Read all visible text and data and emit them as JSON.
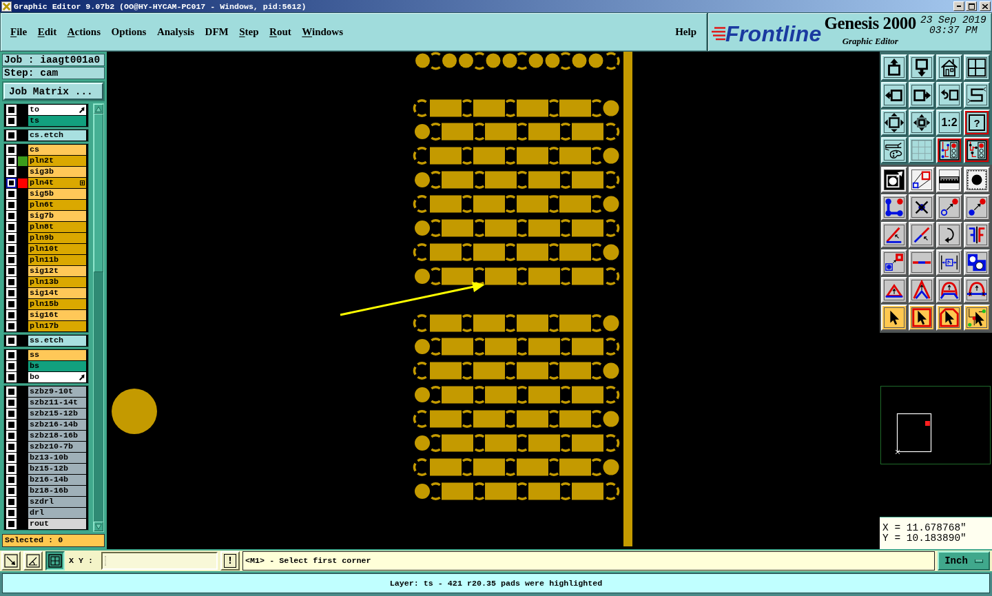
{
  "window": {
    "title": "Graphic Editor 9.07b2 (OO@HY-HYCAM-PC017 - Windows, pid:5612)"
  },
  "menu": [
    {
      "label": "File",
      "underline": true
    },
    {
      "label": "Edit",
      "underline": true
    },
    {
      "label": "Actions",
      "underline": true
    },
    {
      "label": "Options",
      "underline": false
    },
    {
      "label": "Analysis",
      "underline": false
    },
    {
      "label": "DFM",
      "underline": false
    },
    {
      "label": "Step",
      "underline": true
    },
    {
      "label": "Rout",
      "underline": true
    },
    {
      "label": "Windows",
      "underline": true
    }
  ],
  "help_menu": {
    "label": "Help",
    "underline": false
  },
  "brand": {
    "logo": "Frontline",
    "product": "Genesis 2000",
    "subtitle": "Graphic Editor",
    "date": "23 Sep 2019",
    "time": "03:37 PM"
  },
  "job_panel": {
    "job": "Job : iaagt001a0",
    "step": "Step: cam",
    "matrix_button": "Job Matrix ...",
    "selected": "Selected : 0"
  },
  "layer_groups": [
    {
      "layers": [
        {
          "name": "to",
          "kind": "silk",
          "checked": false,
          "selected": false,
          "hand_mark": true,
          "grid_mark": false
        },
        {
          "name": "ts",
          "kind": "mask",
          "checked": false,
          "selected": false,
          "hand_mark": false,
          "grid_mark": false
        }
      ]
    },
    {
      "layers": [
        {
          "name": "cs.etch",
          "kind": "etch",
          "checked": false,
          "selected": false,
          "hand_mark": false,
          "grid_mark": false
        }
      ]
    },
    {
      "layers": [
        {
          "name": "cs",
          "kind": "signal",
          "checked": false,
          "selected": false,
          "hand_mark": false,
          "grid_mark": false
        },
        {
          "name": "pln2t",
          "kind": "power",
          "checked": false,
          "selected": false,
          "hand_mark": false,
          "grid_mark": false,
          "color": "#3c9c1c"
        },
        {
          "name": "sig3b",
          "kind": "signal",
          "checked": false,
          "selected": false,
          "hand_mark": false,
          "grid_mark": false
        },
        {
          "name": "pln4t",
          "kind": "power",
          "checked": false,
          "selected": true,
          "hand_mark": false,
          "grid_mark": true,
          "color": "#ff0000"
        },
        {
          "name": "sig5b",
          "kind": "signal",
          "checked": false,
          "selected": false,
          "hand_mark": false,
          "grid_mark": false
        },
        {
          "name": "pln6t",
          "kind": "power",
          "checked": false,
          "selected": false,
          "hand_mark": false,
          "grid_mark": false
        },
        {
          "name": "sig7b",
          "kind": "signal",
          "checked": false,
          "selected": false,
          "hand_mark": false,
          "grid_mark": false
        },
        {
          "name": "pln8t",
          "kind": "power",
          "checked": false,
          "selected": false,
          "hand_mark": false,
          "grid_mark": false
        },
        {
          "name": "pln9b",
          "kind": "power",
          "checked": false,
          "selected": false,
          "hand_mark": false,
          "grid_mark": false
        },
        {
          "name": "pln10t",
          "kind": "power",
          "checked": false,
          "selected": false,
          "hand_mark": false,
          "grid_mark": false
        },
        {
          "name": "pln11b",
          "kind": "power",
          "checked": false,
          "selected": false,
          "hand_mark": false,
          "grid_mark": false
        },
        {
          "name": "sig12t",
          "kind": "signal",
          "checked": false,
          "selected": false,
          "hand_mark": false,
          "grid_mark": false
        },
        {
          "name": "pln13b",
          "kind": "power",
          "checked": false,
          "selected": false,
          "hand_mark": false,
          "grid_mark": false
        },
        {
          "name": "sig14t",
          "kind": "signal",
          "checked": false,
          "selected": false,
          "hand_mark": false,
          "grid_mark": false
        },
        {
          "name": "pln15b",
          "kind": "power",
          "checked": false,
          "selected": false,
          "hand_mark": false,
          "grid_mark": false
        },
        {
          "name": "sig16t",
          "kind": "signal",
          "checked": false,
          "selected": false,
          "hand_mark": false,
          "grid_mark": false
        },
        {
          "name": "pln17b",
          "kind": "power",
          "checked": false,
          "selected": false,
          "hand_mark": false,
          "grid_mark": false
        }
      ]
    },
    {
      "layers": [
        {
          "name": "ss.etch",
          "kind": "etch",
          "checked": false,
          "selected": false,
          "hand_mark": false,
          "grid_mark": false
        }
      ]
    },
    {
      "layers": [
        {
          "name": "ss",
          "kind": "signal",
          "checked": false,
          "selected": false,
          "hand_mark": false,
          "grid_mark": false
        },
        {
          "name": "bs",
          "kind": "mask",
          "checked": false,
          "selected": false,
          "hand_mark": false,
          "grid_mark": false
        },
        {
          "name": "bo",
          "kind": "silk",
          "checked": false,
          "selected": false,
          "hand_mark": true,
          "grid_mark": false
        }
      ]
    },
    {
      "layers": [
        {
          "name": "szbz9-10t",
          "kind": "drill",
          "checked": false,
          "selected": false,
          "hand_mark": false,
          "grid_mark": false
        },
        {
          "name": "szbz11-14t",
          "kind": "drill",
          "checked": false,
          "selected": false,
          "hand_mark": false,
          "grid_mark": false
        },
        {
          "name": "szbz15-12b",
          "kind": "drill",
          "checked": false,
          "selected": false,
          "hand_mark": false,
          "grid_mark": false
        },
        {
          "name": "szbz16-14b",
          "kind": "drill",
          "checked": false,
          "selected": false,
          "hand_mark": false,
          "grid_mark": false
        },
        {
          "name": "szbz18-16b",
          "kind": "drill",
          "checked": false,
          "selected": false,
          "hand_mark": false,
          "grid_mark": false
        },
        {
          "name": "szbz10-7b",
          "kind": "drill",
          "checked": false,
          "selected": false,
          "hand_mark": false,
          "grid_mark": false
        },
        {
          "name": "bz13-10b",
          "kind": "drill",
          "checked": false,
          "selected": false,
          "hand_mark": false,
          "grid_mark": false
        },
        {
          "name": "bz15-12b",
          "kind": "drill",
          "checked": false,
          "selected": false,
          "hand_mark": false,
          "grid_mark": false
        },
        {
          "name": "bz16-14b",
          "kind": "drill",
          "checked": false,
          "selected": false,
          "hand_mark": false,
          "grid_mark": false
        },
        {
          "name": "bz18-16b",
          "kind": "drill",
          "checked": false,
          "selected": false,
          "hand_mark": false,
          "grid_mark": false
        },
        {
          "name": "szdrl",
          "kind": "drill",
          "checked": false,
          "selected": false,
          "hand_mark": false,
          "grid_mark": false
        },
        {
          "name": "drl",
          "kind": "drill",
          "checked": false,
          "selected": false,
          "hand_mark": false,
          "grid_mark": false
        },
        {
          "name": "rout",
          "kind": "rout",
          "checked": false,
          "selected": false,
          "hand_mark": false,
          "grid_mark": false
        }
      ]
    }
  ],
  "view_tools": [
    {
      "on": false
    },
    {
      "on": false
    },
    {
      "on": false
    },
    {
      "on": false
    },
    {
      "on": false
    },
    {
      "on": false
    },
    {
      "on": false
    },
    {
      "on": false
    },
    {
      "on": false
    },
    {
      "on": false
    },
    {
      "label": "1:2",
      "on": false
    },
    {
      "label": "?",
      "on": true
    },
    {
      "on": false
    },
    {
      "on": false
    },
    {
      "on": true
    },
    {
      "on": true
    }
  ],
  "edit_tools": [
    {
      "kind": "toggle"
    },
    {
      "kind": "toggle"
    },
    {
      "kind": "toggle"
    },
    {
      "kind": "toggle"
    },
    {
      "kind": "edit"
    },
    {
      "kind": "edit"
    },
    {
      "kind": "edit"
    },
    {
      "kind": "edit"
    },
    {
      "kind": "edit"
    },
    {
      "kind": "edit"
    },
    {
      "kind": "edit"
    },
    {
      "kind": "edit"
    },
    {
      "kind": "edit"
    },
    {
      "kind": "edit"
    },
    {
      "kind": "edit"
    },
    {
      "kind": "edit"
    },
    {
      "kind": "edit"
    },
    {
      "kind": "edit"
    },
    {
      "kind": "edit"
    },
    {
      "kind": "edit"
    },
    {
      "kind": "select"
    },
    {
      "kind": "select"
    },
    {
      "kind": "select"
    },
    {
      "kind": "select"
    }
  ],
  "coordinates": {
    "x": "X = 11.678768\"",
    "y": "Y = 10.183890\""
  },
  "command_bar": {
    "tools": [
      {
        "on": false
      },
      {
        "on": false
      },
      {
        "on": true
      }
    ],
    "xy_label": "X Y :",
    "alert_button": "!",
    "prompt": "<M1> - Select first corner",
    "units": "Inch"
  },
  "status_bar": {
    "message": "Layer: ts - 421 r20.35 pads were highlighted"
  }
}
